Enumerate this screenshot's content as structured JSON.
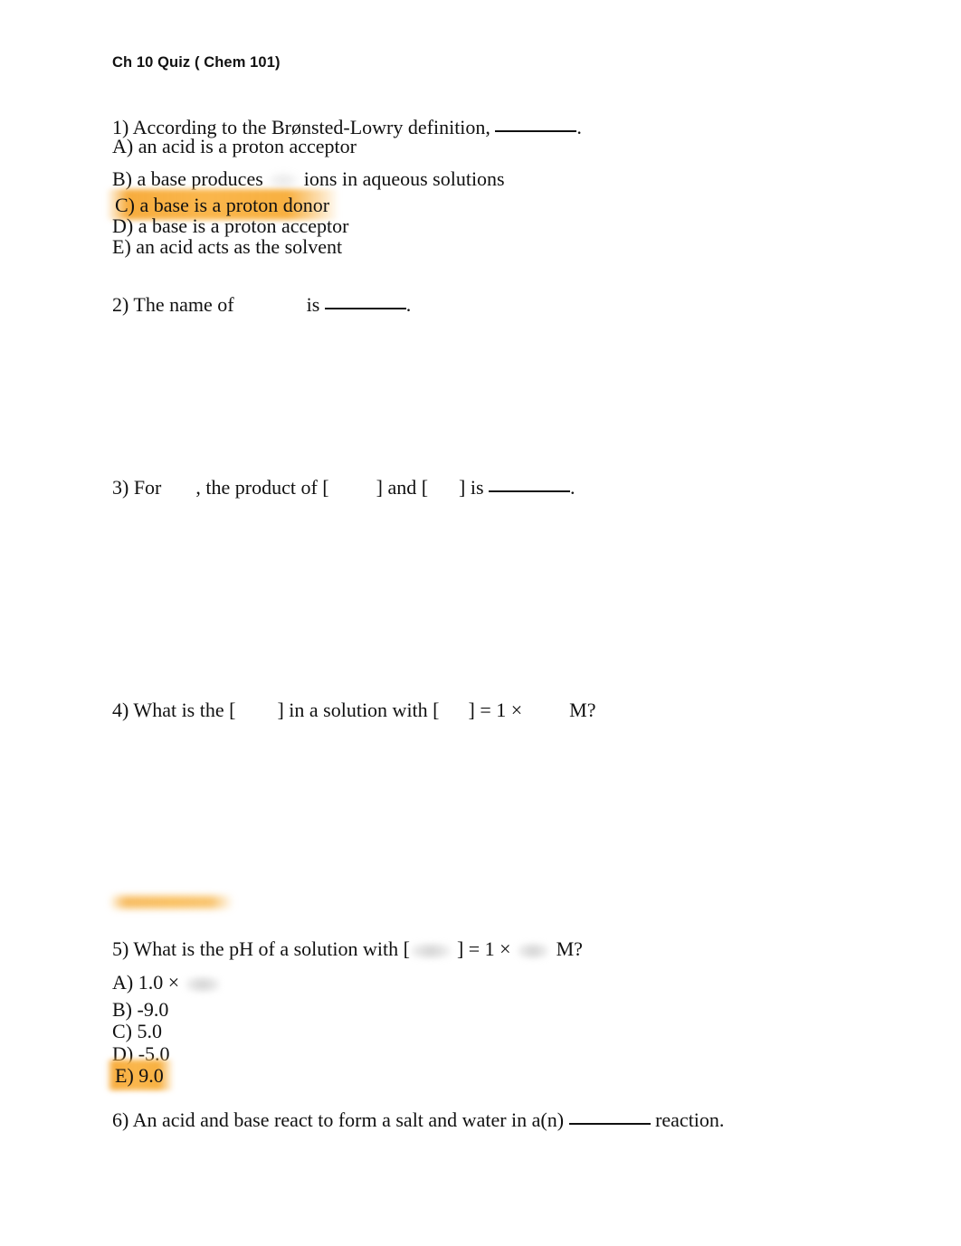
{
  "document": {
    "title": "Ch 10 Quiz ( Chem 101)",
    "page_background": "#ffffff",
    "text_color": "#111111",
    "highlight_color": "#f7a93c"
  },
  "questions": [
    {
      "number": "1)",
      "stem_before": "1) According to the Brønsted-Lowry definition, ",
      "stem_after": ".",
      "options": [
        {
          "label": "A)",
          "text": "A) an acid is a proton acceptor",
          "highlighted": false
        },
        {
          "label": "B)",
          "text_before": "B) a base produces ",
          "text_after": " ions in aqueous solutions",
          "highlighted": false,
          "redacted": true
        },
        {
          "label": "C)",
          "text": "C) a base is a proton donor",
          "highlighted": true
        },
        {
          "label": "D)",
          "text": "D) a base is a proton acceptor",
          "highlighted": false
        },
        {
          "label": "E)",
          "text": "E) an acid acts as the solvent",
          "highlighted": false
        }
      ]
    },
    {
      "number": "2)",
      "stem_part1": "2) The name of",
      "stem_part2": "is ",
      "stem_after": ".",
      "options": []
    },
    {
      "number": "3)",
      "stem_part1": "3) For",
      "stem_part2": ", the product of [",
      "stem_part3": "] and [",
      "stem_part4": "] is ",
      "stem_after": ".",
      "options": []
    },
    {
      "number": "4)",
      "stem_part1": "4) What is the [",
      "stem_part2": "] in a solution with [",
      "stem_part3": "] = 1 ×",
      "stem_part4": "M?",
      "options": []
    },
    {
      "number": "5)",
      "stem_part1": "5) What is the pH of a solution with [",
      "stem_part2": "] = 1 ×",
      "stem_part3": "M?",
      "options": [
        {
          "label": "A)",
          "text": "A) 1.0 ×",
          "highlighted": false,
          "redacted": true
        },
        {
          "label": "B)",
          "text": "B) -9.0",
          "highlighted": false
        },
        {
          "label": "C)",
          "text": "C) 5.0",
          "highlighted": false
        },
        {
          "label": "D)",
          "text": "D) -5.0",
          "highlighted": false
        },
        {
          "label": "E)",
          "text": "E) 9.0",
          "highlighted": true
        }
      ]
    },
    {
      "number": "6)",
      "stem_part1": "6) An acid and base react to form a salt and water in a(n) ",
      "stem_part2": " reaction.",
      "options": []
    }
  ]
}
